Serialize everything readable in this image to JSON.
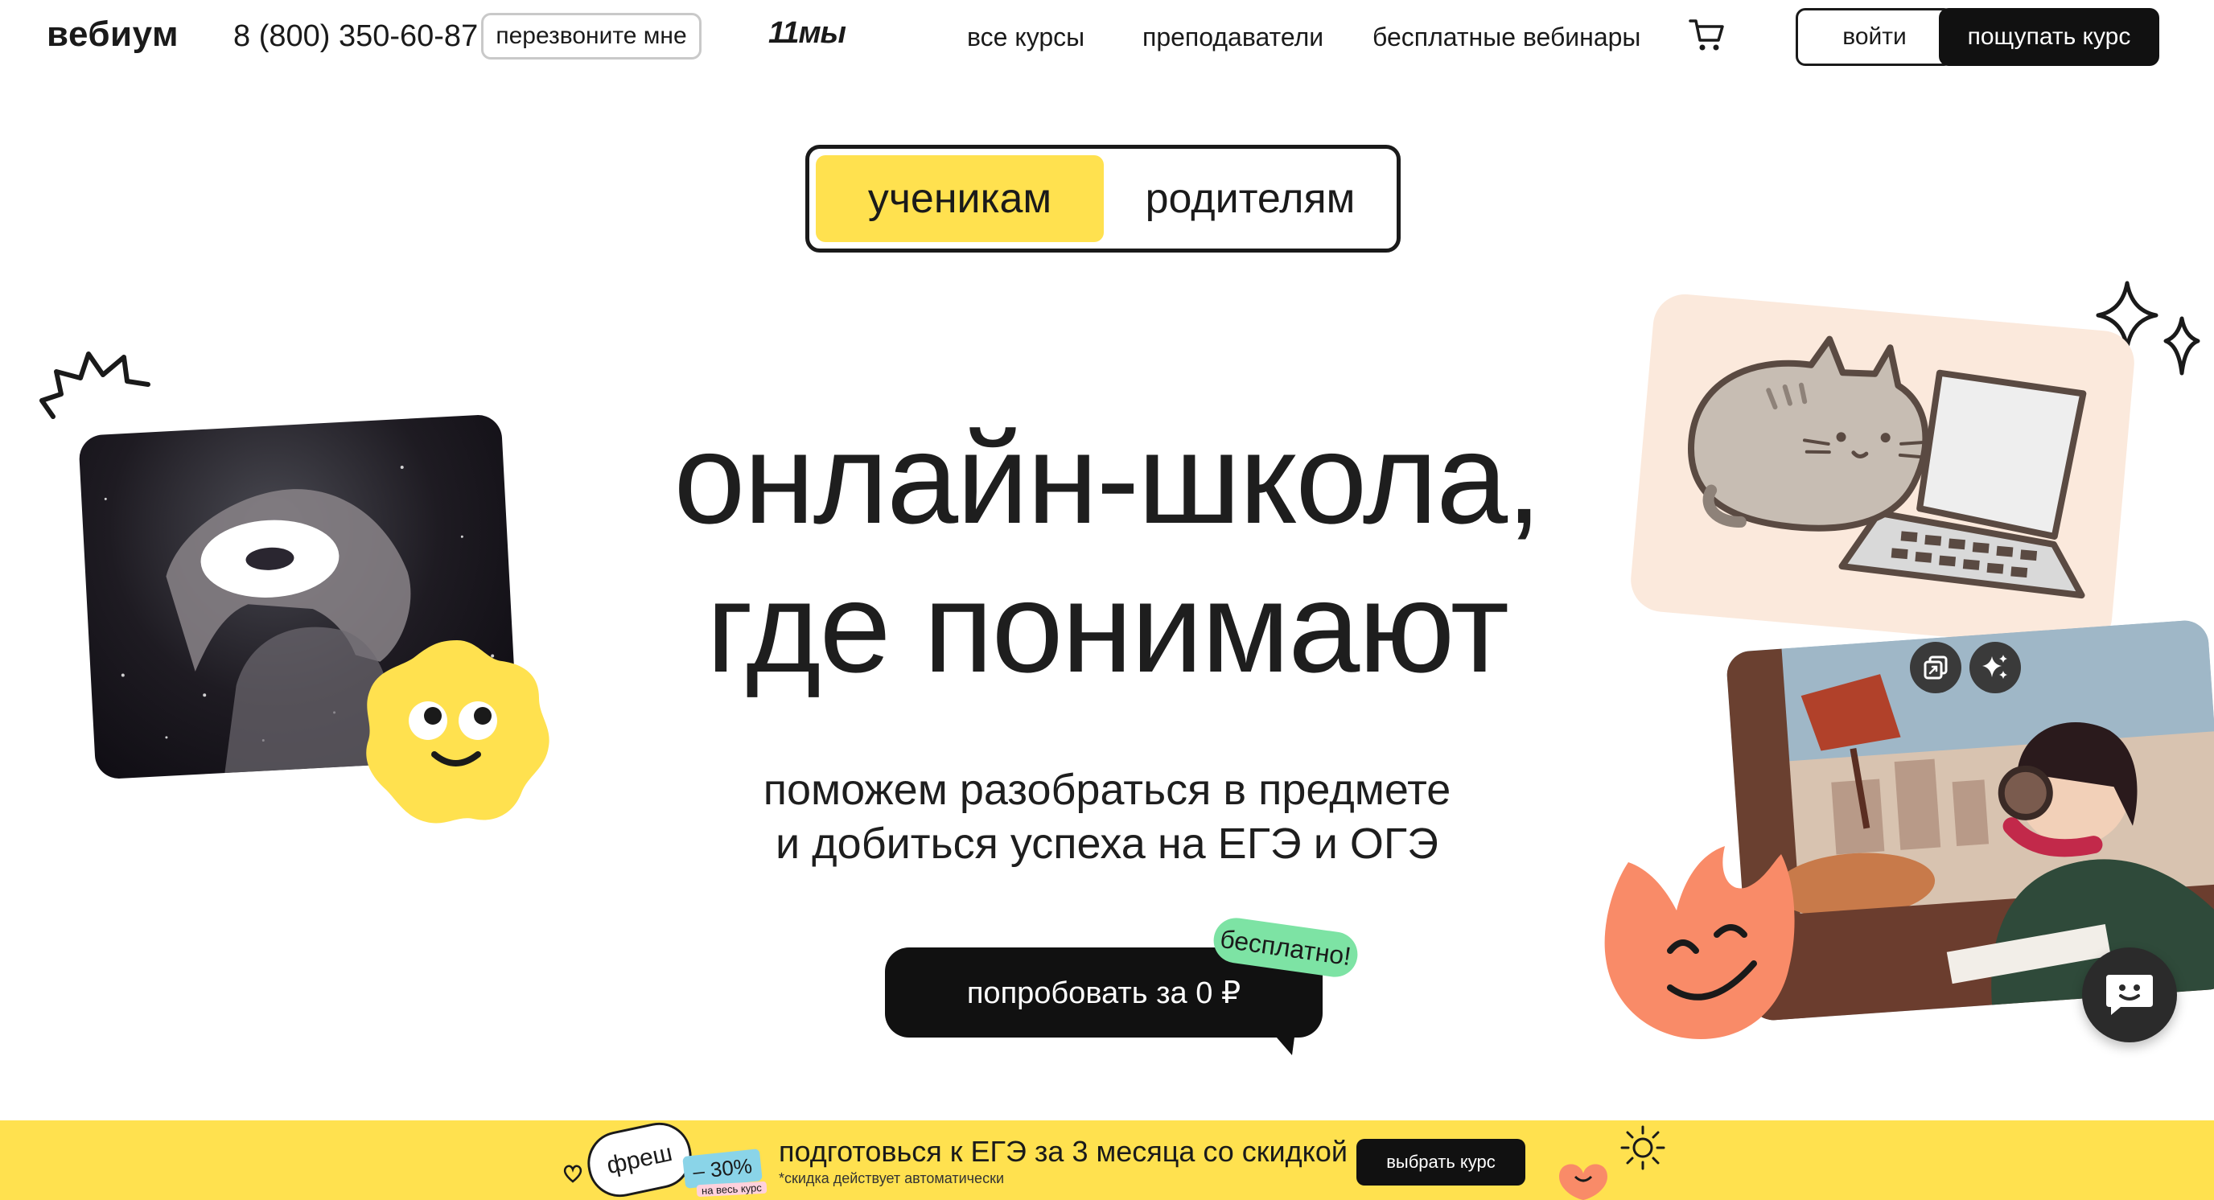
{
  "header": {
    "logo": "вебиум",
    "phone": "8 (800) 350-60-87",
    "callback_label": "перезвоните мне",
    "brand_mark": "11мы",
    "nav": [
      {
        "label": "все курсы"
      },
      {
        "label": "преподаватели"
      },
      {
        "label": "бесплатные вебинары"
      }
    ],
    "login_label": "войти",
    "try_course_label": "пощупать курс"
  },
  "audience_toggle": {
    "active": "ученикам",
    "inactive": "родителям"
  },
  "hero": {
    "title_line1": "онлайн-школа,",
    "title_line2": "где понимают",
    "subtitle_line1": "поможем разобраться в предмете",
    "subtitle_line2": "и добиться успеха на ЕГЭ и ОГЭ",
    "cta_label": "попробовать за 0 ₽",
    "cta_badge": "бесплатно!"
  },
  "promo": {
    "badge": "фреш",
    "discount": "– 30%",
    "discount_note": "на весь курс",
    "text": "подготовься к ЕГЭ за 3 месяца со скидкой",
    "note": "*скидка действует автоматически",
    "button_label": "выбрать курс"
  },
  "colors": {
    "accent_yellow": "#ffe14f",
    "dark": "#111111",
    "badge_green": "#7de3a4",
    "flame_orange": "#f98b68"
  },
  "icons": [
    "cart-icon",
    "copy-icon",
    "sparkle-icon",
    "chat-icon",
    "star-sparkle-icon",
    "burst-icon",
    "sun-icon"
  ]
}
